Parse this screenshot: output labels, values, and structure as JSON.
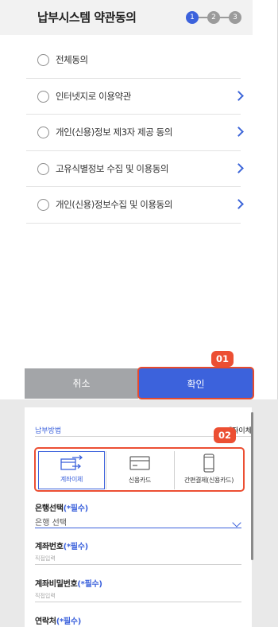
{
  "terms": {
    "title": "납부시스템 약관동의",
    "steps": [
      "1",
      "2",
      "3"
    ],
    "active_step_color": "#3c62dc",
    "inactive_step_color": "#9b9b9b",
    "items": [
      {
        "label": "전체동의",
        "has_detail": false
      },
      {
        "label": "인터넷지로 이용약관",
        "has_detail": true
      },
      {
        "label": "개인(신용)정보 제3자 제공 동의",
        "has_detail": true
      },
      {
        "label": "고유식별정보 수집 및 이용동의",
        "has_detail": true
      },
      {
        "label": "개인(신용)정보수집 및 이용동의",
        "has_detail": true
      }
    ],
    "cancel_label": "취소",
    "confirm_label": "확인",
    "callout_01": "01"
  },
  "payment": {
    "method_label": "납부방법",
    "method_value": "계좌이체",
    "callout_02": "02",
    "options": [
      {
        "label": "계좌이체",
        "icon": "transfer-icon",
        "selected": true
      },
      {
        "label": "신용카드",
        "icon": "credit-card-icon",
        "selected": false
      },
      {
        "label": "간편결제(신용카드)",
        "icon": "mobile-phone-icon",
        "selected": false
      }
    ],
    "bank": {
      "title": "은행선택",
      "required": "(*필수)",
      "value": "은행 선택"
    },
    "account": {
      "title": "계좌번호",
      "required": "(*필수)",
      "placeholder": "직접입력"
    },
    "password": {
      "title": "계좌비밀번호",
      "required": "(*필수)",
      "placeholder": "직접입력"
    },
    "contact": {
      "title": "연락처",
      "required": "(*필수)"
    }
  },
  "colors": {
    "accent": "#3c62dc",
    "callout": "#ec4f33",
    "cancel": "#a3a5a8"
  }
}
